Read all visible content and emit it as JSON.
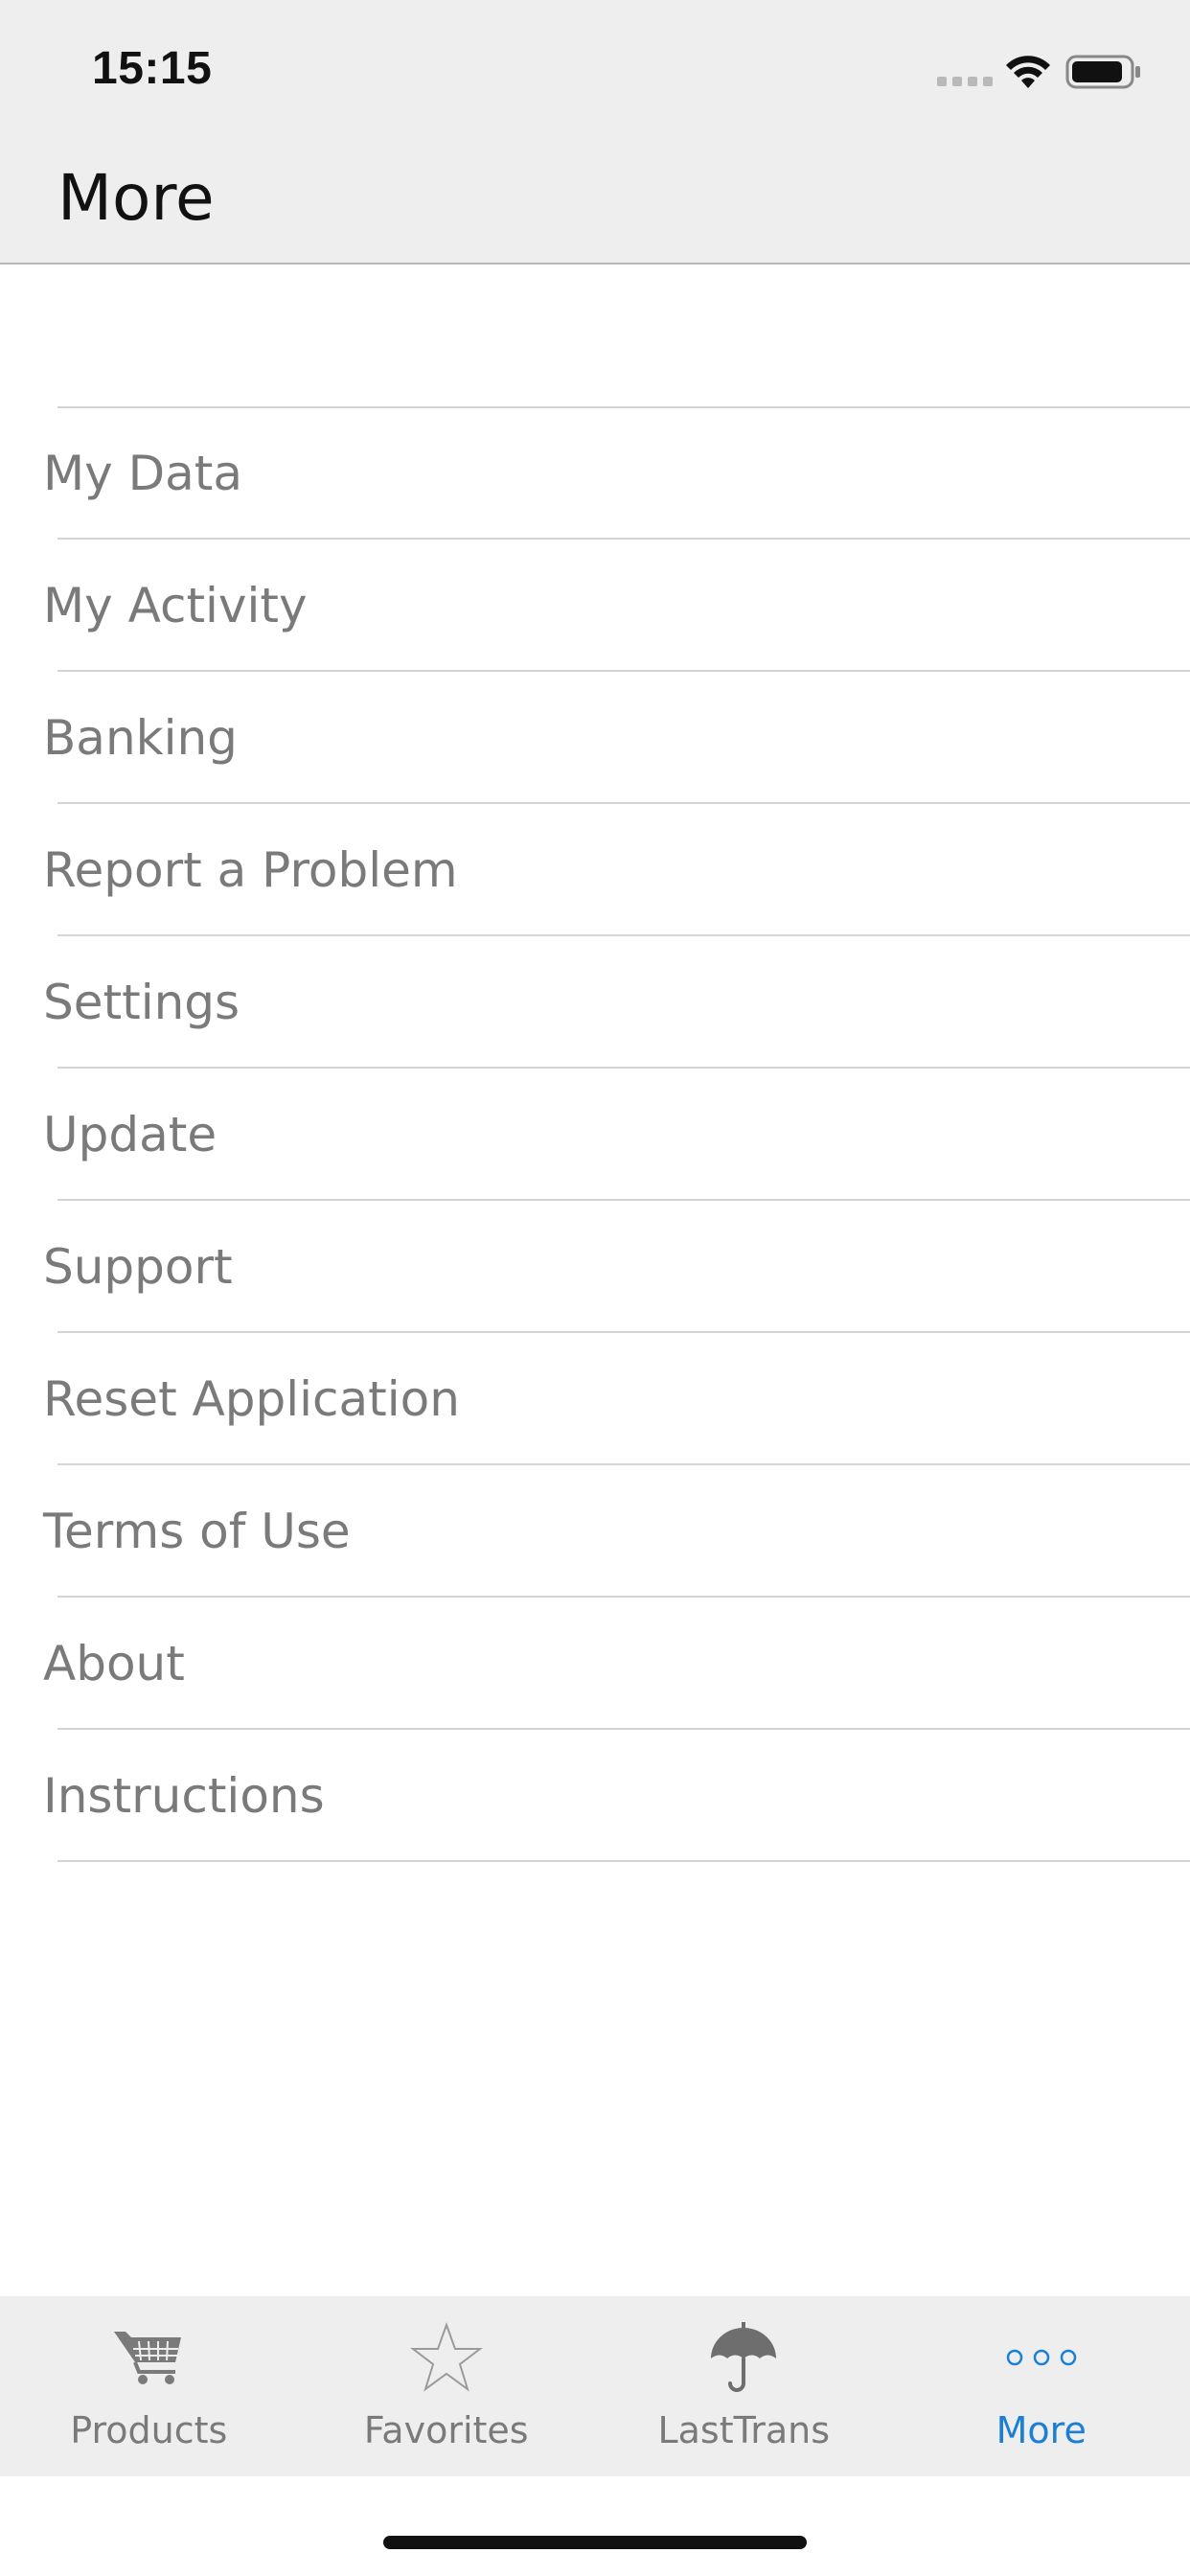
{
  "status_bar": {
    "time": "15:15",
    "signal_icon": "cellular-signal-icon",
    "wifi_icon": "wifi-icon",
    "battery_icon": "battery-icon"
  },
  "nav": {
    "title": "More"
  },
  "menu": {
    "items": [
      {
        "label": "My Data"
      },
      {
        "label": "My Activity"
      },
      {
        "label": "Banking"
      },
      {
        "label": "Report a Problem"
      },
      {
        "label": "Settings"
      },
      {
        "label": "Update"
      },
      {
        "label": "Support"
      },
      {
        "label": "Reset Application"
      },
      {
        "label": "Terms of Use"
      },
      {
        "label": "About"
      },
      {
        "label": "Instructions"
      }
    ]
  },
  "tab_bar": {
    "tabs": [
      {
        "label": "Products",
        "icon": "shopping-cart-icon",
        "active": false
      },
      {
        "label": "Favorites",
        "icon": "star-icon",
        "active": false
      },
      {
        "label": "LastTrans",
        "icon": "umbrella-icon",
        "active": false
      },
      {
        "label": "More",
        "icon": "more-dots-icon",
        "active": true
      }
    ]
  },
  "colors": {
    "bar_background": "#eeeeee",
    "menu_text": "#7a7a7a",
    "separator": "#d4d4d4",
    "active_tab": "#1a7fd6",
    "inactive_tab": "#7a7a7a"
  }
}
